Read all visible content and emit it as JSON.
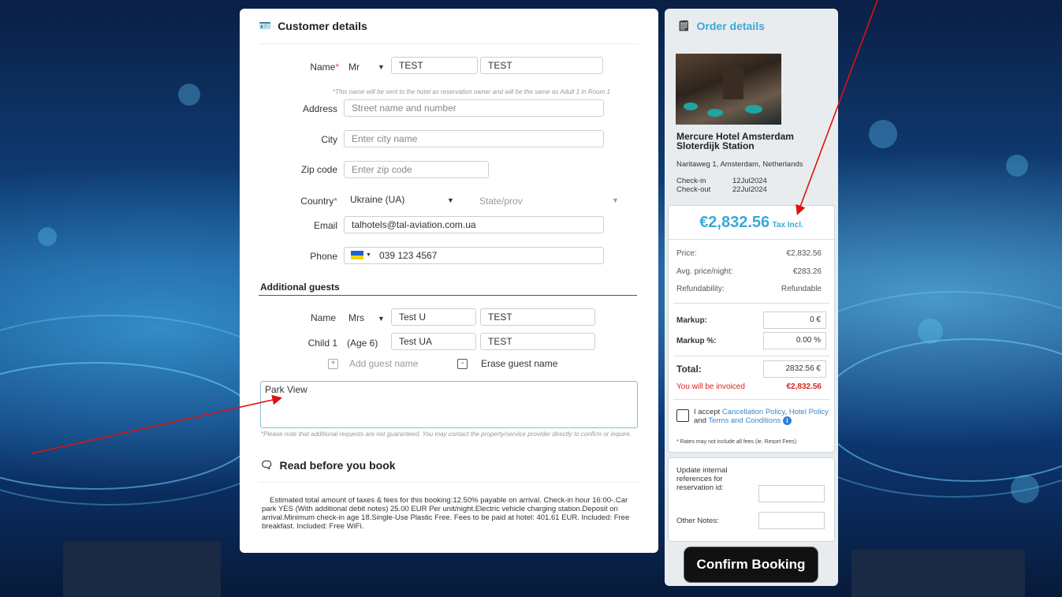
{
  "customer": {
    "header": "Customer details",
    "name_label": "Name",
    "title": "Mr",
    "first_name": "TEST",
    "last_name": "TEST",
    "name_note": "*This name will be sent to the hotel as reservation owner and will be the same as Adult 1 in Room 1",
    "address_label": "Address",
    "address_placeholder": "Street name and number",
    "city_label": "City",
    "city_placeholder": "Enter city name",
    "zip_label": "Zip code",
    "zip_placeholder": "Enter zip code",
    "country_label": "Country",
    "country_value": "Ukraine (UA)",
    "state_placeholder": "State/prov",
    "email_label": "Email",
    "email_value": "talhotels@tal-aviation.com.ua",
    "phone_label": "Phone",
    "phone_value": "039 123 4567"
  },
  "guests": {
    "header": "Additional guests",
    "adult_label": "Name",
    "adult_title": "Mrs",
    "adult_first": "Test U",
    "adult_last": "TEST",
    "child_label": "Child 1",
    "child_age": "(Age 6)",
    "child_first": "Test UA",
    "child_last": "TEST",
    "add_guest": "Add guest name",
    "erase_guest": "Erase guest name"
  },
  "requests": {
    "value": "Park View",
    "note": "*Please note that additional requests are not guaranteed. You may contact the property/service provider directly to confirm or inquire."
  },
  "read_before": {
    "header": "Read before you book",
    "text": "Estimated total amount of taxes & fees for this booking:12.50% payable on arrival.  Check-in hour 16:00-.Car park YES (With additional debit notes) 25.00 EUR Per unit/night.Electric vehicle charging station.Deposit on arrival.Minimum check-in age 18.Single-Use Plastic Free. Fees to be paid at hotel: 401.61 EUR. Included: Free breakfast. Included: Free WiFi."
  },
  "order": {
    "header": "Order details",
    "hotel_name": "Mercure Hotel Amsterdam Sloterdijk Station",
    "address": "Naritaweg 1, Amsterdam, Netherlands",
    "checkin_label": "Check-in",
    "checkin_value": "12Jul2024",
    "checkout_label": "Check-out",
    "checkout_value": "22Jul2024",
    "total_price": "€2,832.56",
    "tax_label": "Tax Incl.",
    "price_label": "Price:",
    "price_value": "€2,832.56",
    "avg_label": "Avg. price/night:",
    "avg_value": "€283.26",
    "refund_label": "Refundability:",
    "refund_value": "Refundable",
    "markup_label": "Markup:",
    "markup_value": "0 €",
    "markup_pct_label": "Markup %:",
    "markup_pct_value": "0.00 %",
    "total_label": "Total:",
    "total_value": "2832.56 €",
    "invoiced_label": "You will be invoiced",
    "invoiced_value": "€2,832.56",
    "accept_prefix": "I accept",
    "cancel_policy": "Cancellation Policy",
    "hotel_policy": "Hotel Policy",
    "and_text": "and",
    "terms": "Terms and Conditions",
    "fees_note": "* Rates may not include all fees (ie. Resort Fees)",
    "internal_ref_label": "Update internal references for reservation id:",
    "other_notes_label": "Other Notes:",
    "confirm_button": "Confirm Booking"
  },
  "colors": {
    "accent": "#3aa8d8",
    "required": "#d9534f",
    "invoiced": "#d9241c"
  }
}
